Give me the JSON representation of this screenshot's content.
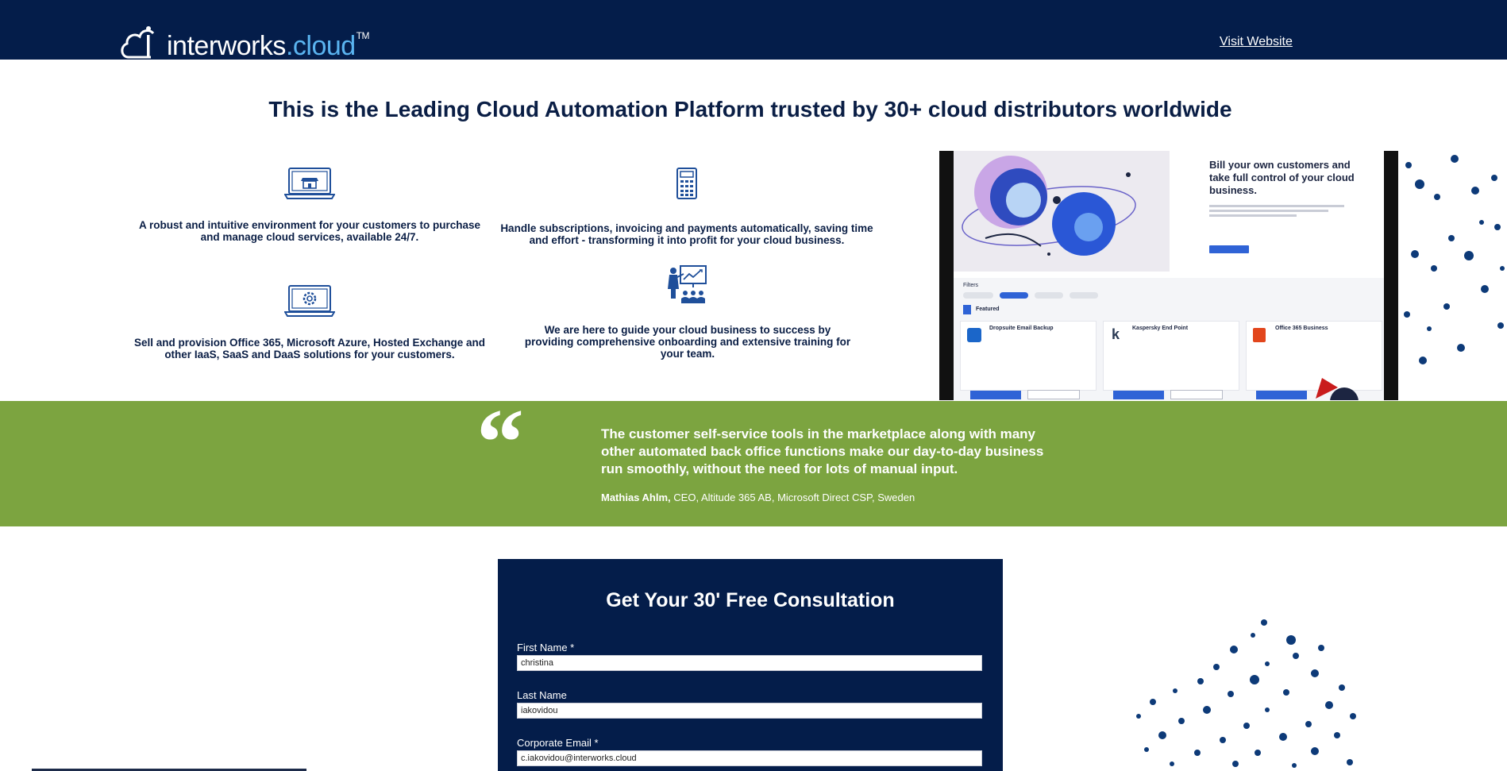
{
  "header": {
    "logo_main": "interworks",
    "logo_dot": ".cloud",
    "logo_tm": "TM",
    "visit_link": "Visit Website"
  },
  "headline": "This is the Leading Cloud Automation Platform trusted by 30+ cloud distributors worldwide",
  "features": [
    {
      "icon": "storefront-laptop-icon",
      "text": "A robust and intuitive environment for your customers to purchase and manage cloud services, available 24/7."
    },
    {
      "icon": "calculator-icon",
      "text": "Handle subscriptions, invoicing and payments automatically, saving time and effort - transforming it into profit for your cloud business."
    },
    {
      "icon": "gear-laptop-icon",
      "text": "Sell and provision Office 365, Microsoft Azure, Hosted Exchange and other IaaS, SaaS and DaaS solutions for your customers."
    },
    {
      "icon": "presenter-training-icon",
      "text": "We are here to guide your cloud business to success by providing comprehensive onboarding and extensive training for your team."
    }
  ],
  "mockup": {
    "title": "Bill your own customers and take full control of your cloud business.",
    "filters_label": "Filters",
    "featured_label": "Featured",
    "cards": [
      "Dropsuite Email Backup",
      "Kaspersky End Point",
      "Office 365 Business"
    ]
  },
  "testimonial": {
    "quote": "The customer self-service tools in the marketplace along with many other automated back office functions make our day-to-day business run smoothly, without the need for lots of manual input.",
    "author_name": "Mathias Ahlm,",
    "author_role": " CEO, Altitude 365 AB, Microsoft Direct CSP, Sweden"
  },
  "form": {
    "title": "Get Your 30' Free Consultation",
    "first_name_label": "First Name *",
    "first_name_value": "christina",
    "last_name_label": "Last Name",
    "last_name_value": "iakovidou",
    "email_label": "Corporate Email *",
    "email_value": "c.iakovidou@interworks.cloud"
  },
  "colors": {
    "navy": "#041d4a",
    "green": "#7ca440",
    "star_blue": "#0d3a78"
  }
}
